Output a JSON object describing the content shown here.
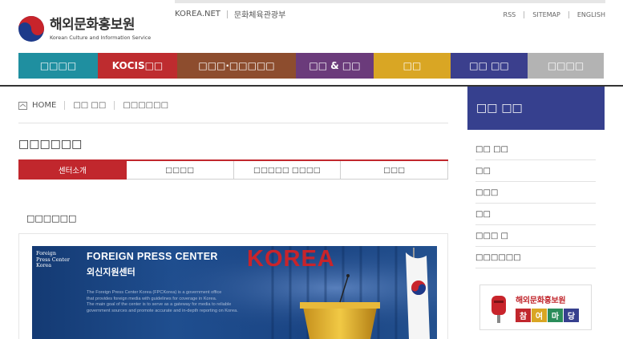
{
  "header": {
    "logo_ko": "해외문화홍보원",
    "logo_en": "Korean Culture and Information Service",
    "portal_links": [
      "KOREA.NET",
      "문화체육관광부"
    ],
    "util_links": [
      "RSS",
      "SITEMAP",
      "ENGLISH"
    ]
  },
  "gnb": {
    "items": [
      {
        "label": "□□□□",
        "color": "#1f8fa0"
      },
      {
        "label": "KOCIS□□",
        "color": "#be2c2f"
      },
      {
        "label": "□□□·□□□□□",
        "color": "#8d4d2e"
      },
      {
        "label": "□□ & □□",
        "color": "#6b3b7b"
      },
      {
        "label": "□□",
        "color": "#d9a624"
      },
      {
        "label": "□□ □□",
        "color": "#3b3f8d"
      },
      {
        "label": "□□□□",
        "color": "#b3b3b3"
      }
    ]
  },
  "breadcrumb": {
    "home": "HOME",
    "items": [
      "□□ □□",
      "□□□□□□"
    ]
  },
  "page": {
    "title": "□□□□□□",
    "sub_title": "□□□□□□"
  },
  "tabs": [
    {
      "label": "센터소개",
      "active": true
    },
    {
      "label": "□□□□",
      "active": false
    },
    {
      "label": "□□□□□ □□□□",
      "active": false
    },
    {
      "label": "□□□",
      "active": false
    }
  ],
  "banner": {
    "logo_text": [
      "Foreign",
      "Press Center",
      "Korea"
    ],
    "title": "FOREIGN PRESS CENTER",
    "korea": "KOREA",
    "ko_title": "외신지원센터",
    "desc": [
      "The Foreign Press Center Korea (FPCKorea) is a government office",
      "that provides foreign media with guidelines for coverage in Korea.",
      "The main goal of the center is to serve as a gateway for media to reliable",
      "government sources and promote accurate and in-depth reporting on Korea."
    ]
  },
  "sidebar": {
    "title": "□□ □□",
    "items": [
      "□□ □□",
      "□□",
      "□□□",
      "□□",
      "□□□ □",
      "□□□□□□"
    ],
    "banner_top": "해외문화홍보원",
    "banner_chars": [
      "참",
      "여",
      "마",
      "당"
    ],
    "banner_colors": [
      "#c1272d",
      "#d9a624",
      "#2a8c5a",
      "#36408e"
    ]
  }
}
